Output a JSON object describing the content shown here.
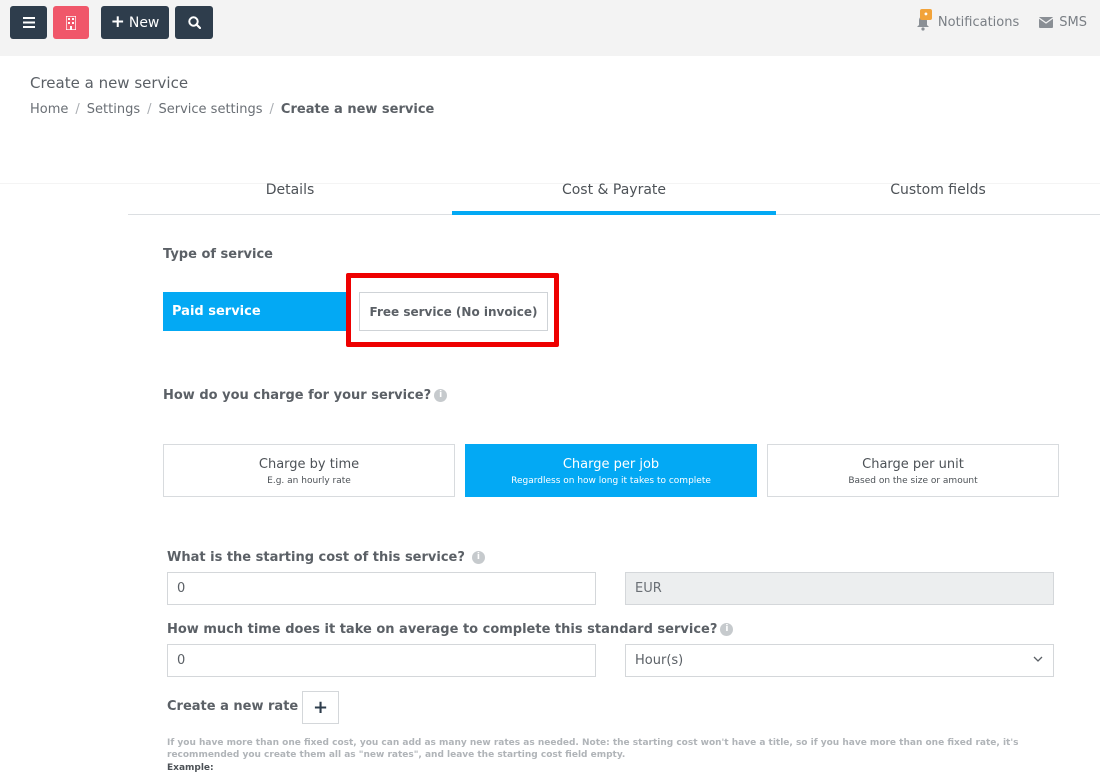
{
  "topbar": {
    "new_label": "New",
    "notifications_label": "Notifications",
    "sms_label": "SMS",
    "accent_color": "#03a9f4",
    "dark_color": "#2e3d4c",
    "pink_color": "#f0576a"
  },
  "page": {
    "title": "Create a new service",
    "breadcrumb": [
      "Home",
      "Settings",
      "Service settings",
      "Create a new service"
    ]
  },
  "tabs": [
    {
      "label": "Details",
      "active": false
    },
    {
      "label": "Cost & Payrate",
      "active": true
    },
    {
      "label": "Custom fields",
      "active": false
    }
  ],
  "service_type": {
    "label": "Type of service",
    "paid": "Paid service",
    "free": "Free service (No invoice)",
    "selected": "paid"
  },
  "charge": {
    "question": "How do you charge for your service?",
    "options": [
      {
        "title": "Charge by time",
        "sub": "E.g. an hourly rate",
        "active": false
      },
      {
        "title": "Charge per job",
        "sub": "Regardless on how long it takes to complete",
        "active": true
      },
      {
        "title": "Charge per unit",
        "sub": "Based on the size or amount",
        "active": false
      }
    ]
  },
  "starting_cost": {
    "label": "What is the starting cost of this service?",
    "value": "0",
    "currency": "EUR"
  },
  "time": {
    "label": "How much time does it take on average to complete this standard service?",
    "value": "0",
    "unit": "Hour(s)"
  },
  "rate": {
    "label": "Create a new rate",
    "note": "If you have more than one fixed cost, you can add as many new rates as needed. Note: the starting cost won't have a title, so if you have more than one fixed rate, it's recommended you create them all as \"new rates\", and leave the starting cost field empty.",
    "example": "Example:"
  }
}
